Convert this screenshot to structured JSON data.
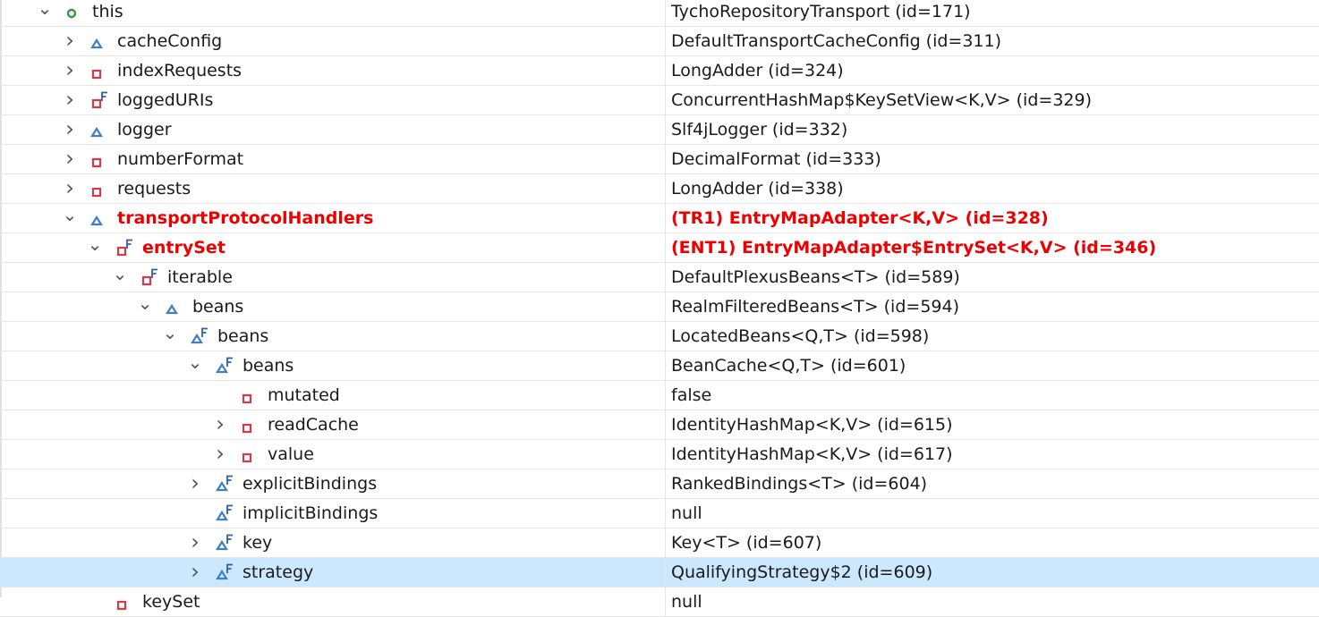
{
  "variables": [
    {
      "name": "this",
      "value": "TychoRepositoryTransport  (id=171)",
      "depth": 0,
      "expander": "expanded",
      "icon": "local-variable-icon",
      "changed": false,
      "selected": false
    },
    {
      "name": "cacheConfig",
      "value": "DefaultTransportCacheConfig  (id=311)",
      "depth": 1,
      "expander": "collapsed",
      "icon": "protected-field-icon",
      "changed": false,
      "selected": false
    },
    {
      "name": "indexRequests",
      "value": "LongAdder  (id=324)",
      "depth": 1,
      "expander": "collapsed",
      "icon": "private-field-icon",
      "changed": false,
      "selected": false
    },
    {
      "name": "loggedURIs",
      "value": "ConcurrentHashMap$KeySetView<K,V>  (id=329)",
      "depth": 1,
      "expander": "collapsed",
      "icon": "private-final-field-icon",
      "changed": false,
      "selected": false
    },
    {
      "name": "logger",
      "value": "Slf4jLogger  (id=332)",
      "depth": 1,
      "expander": "collapsed",
      "icon": "protected-field-icon",
      "changed": false,
      "selected": false
    },
    {
      "name": "numberFormat",
      "value": "DecimalFormat  (id=333)",
      "depth": 1,
      "expander": "collapsed",
      "icon": "private-field-icon",
      "changed": false,
      "selected": false
    },
    {
      "name": "requests",
      "value": "LongAdder  (id=338)",
      "depth": 1,
      "expander": "collapsed",
      "icon": "private-field-icon",
      "changed": false,
      "selected": false
    },
    {
      "name": "transportProtocolHandlers",
      "value": "(TR1) EntryMapAdapter<K,V>  (id=328)",
      "depth": 1,
      "expander": "expanded",
      "icon": "protected-field-icon",
      "changed": true,
      "selected": false
    },
    {
      "name": "entrySet",
      "value": "(ENT1) EntryMapAdapter$EntrySet<K,V>  (id=346)",
      "depth": 2,
      "expander": "expanded",
      "icon": "private-final-field-icon",
      "changed": true,
      "selected": false
    },
    {
      "name": "iterable",
      "value": "DefaultPlexusBeans<T>  (id=589)",
      "depth": 3,
      "expander": "expanded",
      "icon": "private-final-field-icon",
      "changed": false,
      "selected": false
    },
    {
      "name": "beans",
      "value": "RealmFilteredBeans<T>  (id=594)",
      "depth": 4,
      "expander": "expanded",
      "icon": "protected-field-icon",
      "changed": false,
      "selected": false
    },
    {
      "name": "beans",
      "value": "LocatedBeans<Q,T>  (id=598)",
      "depth": 5,
      "expander": "expanded",
      "icon": "protected-final-field-icon",
      "changed": false,
      "selected": false
    },
    {
      "name": "beans",
      "value": "BeanCache<Q,T>  (id=601)",
      "depth": 6,
      "expander": "expanded",
      "icon": "protected-final-field-icon",
      "changed": false,
      "selected": false
    },
    {
      "name": "mutated",
      "value": "false",
      "depth": 7,
      "expander": "none",
      "icon": "private-field-icon",
      "changed": false,
      "selected": false
    },
    {
      "name": "readCache",
      "value": "IdentityHashMap<K,V>  (id=615)",
      "depth": 7,
      "expander": "collapsed",
      "icon": "private-field-icon",
      "changed": false,
      "selected": false
    },
    {
      "name": "value",
      "value": "IdentityHashMap<K,V>  (id=617)",
      "depth": 7,
      "expander": "collapsed",
      "icon": "private-field-icon",
      "changed": false,
      "selected": false
    },
    {
      "name": "explicitBindings",
      "value": "RankedBindings<T>  (id=604)",
      "depth": 6,
      "expander": "collapsed",
      "icon": "protected-final-field-icon",
      "changed": false,
      "selected": false
    },
    {
      "name": "implicitBindings",
      "value": "null",
      "depth": 6,
      "expander": "none",
      "icon": "protected-final-field-icon",
      "changed": false,
      "selected": false
    },
    {
      "name": "key",
      "value": "Key<T>  (id=607)",
      "depth": 6,
      "expander": "collapsed",
      "icon": "protected-final-field-icon",
      "changed": false,
      "selected": false
    },
    {
      "name": "strategy",
      "value": "QualifyingStrategy$2  (id=609)",
      "depth": 6,
      "expander": "collapsed",
      "icon": "protected-final-field-icon",
      "changed": false,
      "selected": true
    },
    {
      "name": "keySet",
      "value": "null",
      "depth": 2,
      "expander": "none",
      "icon": "private-field-icon",
      "changed": false,
      "selected": false
    }
  ],
  "colors": {
    "changed_text": "#ee0000",
    "selection": "#cce8ff",
    "protected_icon": "#3f7fc4",
    "private_icon": "#d63a4a",
    "local_icon": "#2e9a4a",
    "final_marker": "#2b5fb0"
  }
}
